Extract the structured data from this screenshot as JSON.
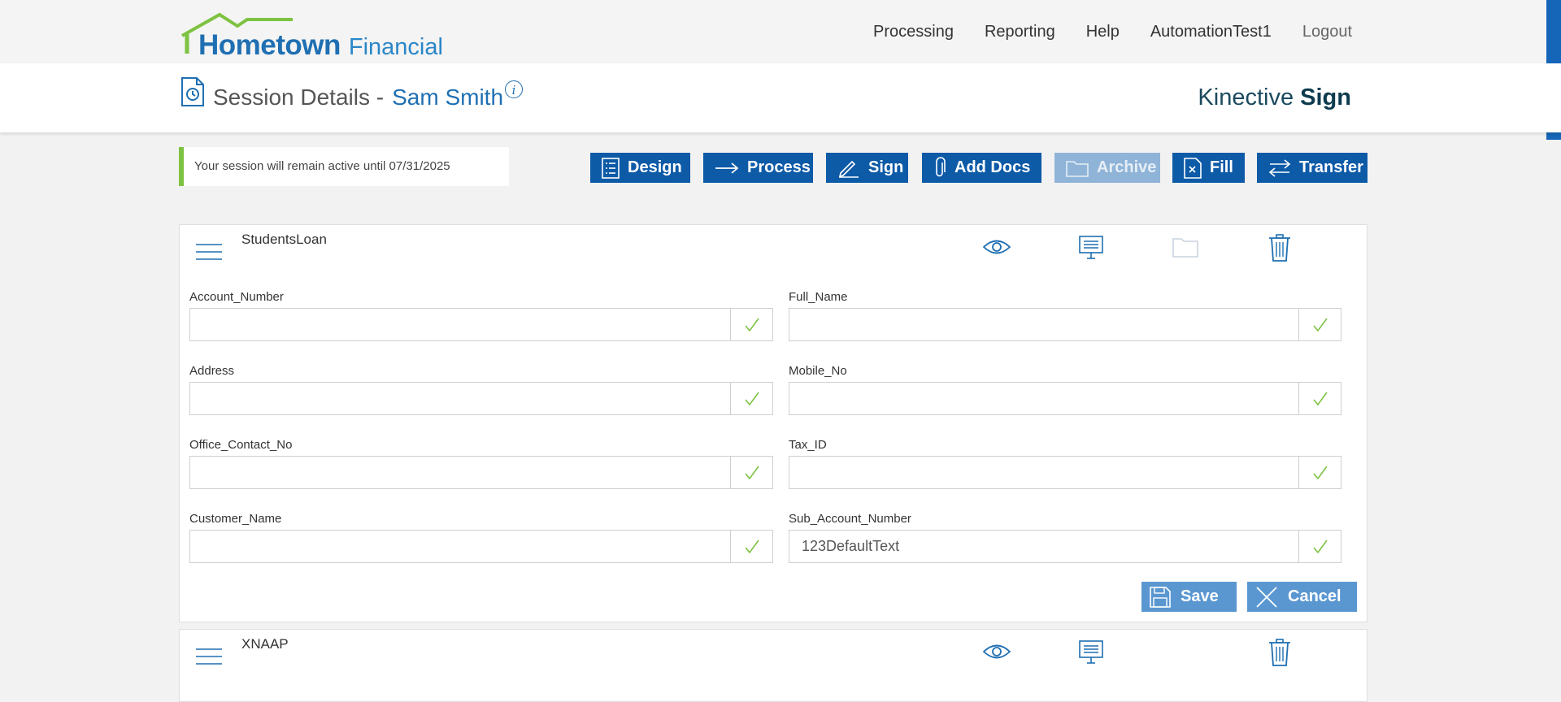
{
  "brand": {
    "name": "Hometown",
    "suffix": "Financial"
  },
  "nav": {
    "processing": "Processing",
    "reporting": "Reporting",
    "help": "Help",
    "user": "AutomationTest1",
    "logout": "Logout"
  },
  "header": {
    "title_prefix": "Session Details -",
    "customer": "Sam Smith",
    "info": "i",
    "product_light": "Kinective",
    "product_bold": "Sign"
  },
  "notice": "Your session will remain active until 07/31/2025",
  "actions": {
    "design": "Design",
    "process": "Process",
    "sign": "Sign",
    "add_docs": "Add Docs",
    "archive": "Archive",
    "fill": "Fill",
    "transfer": "Transfer"
  },
  "panel": {
    "title": "StudentsLoan",
    "fields": [
      {
        "label": "Account_Number",
        "value": ""
      },
      {
        "label": "Full_Name",
        "value": ""
      },
      {
        "label": "Address",
        "value": ""
      },
      {
        "label": "Mobile_No",
        "value": ""
      },
      {
        "label": "Office_Contact_No",
        "value": ""
      },
      {
        "label": "Tax_ID",
        "value": ""
      },
      {
        "label": "Customer_Name",
        "value": ""
      },
      {
        "label": "Sub_Account_Number",
        "value": "123DefaultText"
      }
    ],
    "save": "Save",
    "cancel": "Cancel"
  },
  "panel2": {
    "title": "XNAAP"
  },
  "colors": {
    "primary": "#0d5aa7",
    "accent_green": "#7dc241",
    "disabled": "#8fb4d8"
  }
}
